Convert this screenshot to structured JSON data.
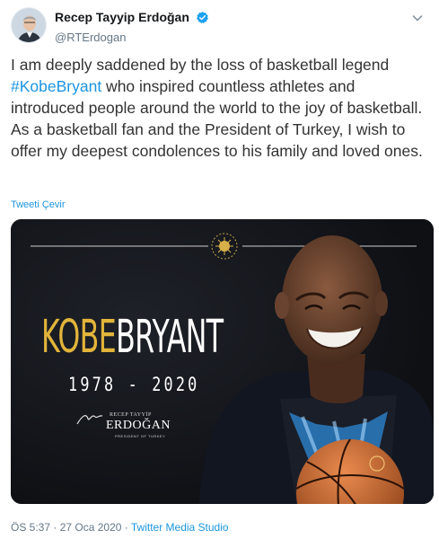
{
  "tweet": {
    "author": {
      "display_name": "Recep Tayyip Erdoğan",
      "handle": "@RTErdogan",
      "verified": true,
      "avatar_icon": "user-avatar"
    },
    "text_before": "I am deeply saddened by the loss of basketball legend ",
    "hashtag": "#KobeBryant",
    "text_after": " who inspired countless athletes and introduced people around the world to the joy of basketball. As a basketball fan and the President of Turkey, I wish to offer my deepest condolences to his family and loved ones.",
    "translate_label": "Tweeti Çevir",
    "media": {
      "title_first": "KOBE",
      "title_last": "BRYANT",
      "years": "1978 - 2020",
      "signature_small": "RECEP TAYYİP",
      "signature_name": "ERDOĞAN",
      "signature_role": "PRESIDENT OF TURKEY",
      "emblem_icon": "presidential-seal"
    },
    "timestamp": "ÖS 5:37 · 27 Oca 2020 · ",
    "source": "Twitter Media Studio"
  },
  "colors": {
    "link": "#1b95e0",
    "gold": "#e2b43a",
    "media_bg": "#121419",
    "muted": "#657786"
  }
}
